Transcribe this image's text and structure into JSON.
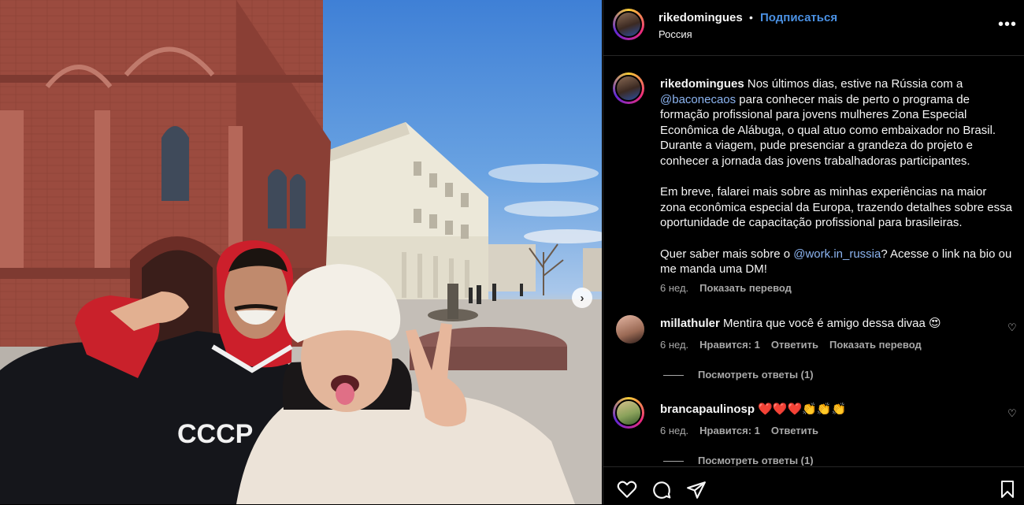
{
  "post": {
    "username": "rikedomingues",
    "separator": "•",
    "follow_label": "Подписаться",
    "location": "Россия",
    "more_label": "•••"
  },
  "caption": {
    "username": "rikedomingues",
    "p1_a": " Nos últimos dias, estive na Rússia com a ",
    "mention1": "@baconecaos",
    "p1_b": " para conhecer mais de perto o programa de formação profissional para jovens mulheres Zona Especial Econômica de Alábuga, o qual atuo como embaixador no Brasil. Durante a viagem, pude presenciar a grandeza do projeto e conhecer a jornada das jovens trabalhadoras participantes.",
    "p2": "Em breve, falarei mais sobre as minhas experiências na maior zona econômica especial da Europa, trazendo detalhes sobre essa oportunidade de capacitação profissional para brasileiras.",
    "p3_a": "Quer saber mais sobre o ",
    "mention2": "@work.in_russia",
    "p3_b": "? Acesse o link na bio ou me manda uma DM!",
    "time": "6 нед.",
    "translate": "Показать перевод"
  },
  "comments": [
    {
      "username": "millathuler",
      "text": "Mentira que você é amigo dessa divaa 😍",
      "time": "6 нед.",
      "likes": "Нравится: 1",
      "reply": "Ответить",
      "translate": "Показать перевод",
      "view_replies": "Посмотреть ответы (1)"
    },
    {
      "username": "brancapaulinosp",
      "text": "❤️❤️❤️👏👏👏",
      "time": "6 нед.",
      "likes": "Нравится: 1",
      "reply": "Ответить",
      "view_replies": "Посмотреть ответы (1)"
    }
  ],
  "photo": {
    "jacket_text": "СССР"
  },
  "icons": [
    "heart-icon",
    "comment-icon",
    "share-icon",
    "bookmark-icon",
    "chevron-right-icon",
    "more-icon"
  ],
  "colors": {
    "link": "#4a90e2",
    "mention": "#8cb4f0",
    "muted": "#a8a8a8",
    "background": "#000000"
  }
}
